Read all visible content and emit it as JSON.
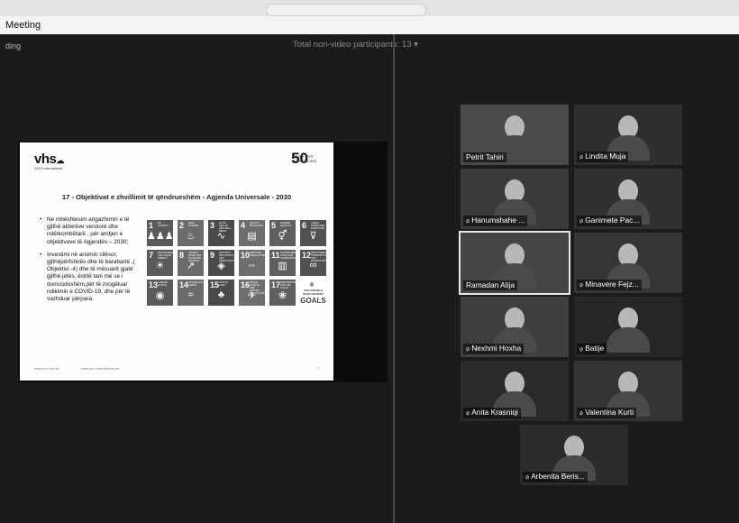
{
  "window": {
    "title": "Meeting"
  },
  "toolbar": {
    "recording_label": "ding",
    "participants_summary": "Total non-video participants: 13"
  },
  "slide": {
    "logo_left": "vhs",
    "logo_left_sub": "DVV International",
    "logo_right_num": "50",
    "logo_right_sub": "Years DVV International",
    "title": "17 - Objektivat e zhvillimit të qëndrueshëm - Agjenda Universale - 2030",
    "bullets": [
      "Ne mbështesim angazhimin e të gjithë akterëve vendorë dhe ndërkombëtarë , për arritjen e objektivave  të Agjendës – 2030;",
      "Investimi në arsimin cilësor, gjithëpërfshirës dhe të barabartë ,( Objektivi -4) dhe të mësuarit gjatë gjithë jetës, është  tani më se i domosdoshëm,për të zvogëluar ndikimin e COVID-19, dhe për të vazhduar përpara."
    ],
    "sdg_tiles": [
      {
        "num": "1",
        "label": "NO POVERTY",
        "icon": "♟♟♟"
      },
      {
        "num": "2",
        "label": "ZERO HUNGER",
        "icon": "♨"
      },
      {
        "num": "3",
        "label": "GOOD HEALTH AND WELL-BEING",
        "icon": "∿"
      },
      {
        "num": "4",
        "label": "QUALITY EDUCATION",
        "icon": "▤"
      },
      {
        "num": "5",
        "label": "GENDER EQUALITY",
        "icon": "⚥"
      },
      {
        "num": "6",
        "label": "CLEAN WATER AND SANITATION",
        "icon": "⊽"
      },
      {
        "num": "7",
        "label": "AFFORDABLE AND CLEAN ENERGY",
        "icon": "☀"
      },
      {
        "num": "8",
        "label": "DECENT WORK AND ECONOMIC GROWTH",
        "icon": "↗"
      },
      {
        "num": "9",
        "label": "INDUSTRY, INNOVATION AND INFRASTRUCTURE",
        "icon": "◈"
      },
      {
        "num": "10",
        "label": "REDUCED INEQUALITIES",
        "icon": "⇔"
      },
      {
        "num": "11",
        "label": "SUSTAINABLE CITIES AND COMMUNITIES",
        "icon": "▥"
      },
      {
        "num": "12",
        "label": "RESPONSIBLE CONSUMPTION AND PRODUCTION",
        "icon": "∞"
      },
      {
        "num": "13",
        "label": "CLIMATE ACTION",
        "icon": "◉"
      },
      {
        "num": "14",
        "label": "LIFE BELOW WATER",
        "icon": "≈"
      },
      {
        "num": "15",
        "label": "LIFE ON LAND",
        "icon": "♣"
      },
      {
        "num": "16",
        "label": "PEACE, JUSTICE AND STRONG INSTITUTIONS",
        "icon": "✈"
      },
      {
        "num": "17",
        "label": "PARTNERSHIPS FOR THE GOALS",
        "icon": "❀"
      }
    ],
    "goals_small": "SUSTAINABLE DEVELOPMENT",
    "goals_big": "GOALS",
    "footer_left": "www.dvv-vhs.de",
    "footer_mid": "www.dvv-international.de",
    "page_num": "7"
  },
  "participants": [
    {
      "name": "Petrit Tahiri",
      "muted": false,
      "video": true,
      "active": false
    },
    {
      "name": "Lindita Muja",
      "muted": true,
      "video": true,
      "active": false
    },
    {
      "name": "Hanumshahe ...",
      "muted": true,
      "video": true,
      "active": false
    },
    {
      "name": "Ganimete Pac...",
      "muted": true,
      "video": true,
      "active": false
    },
    {
      "name": "Ramadan Alija",
      "muted": false,
      "video": true,
      "active": true
    },
    {
      "name": "Minavere Fejz...",
      "muted": true,
      "video": true,
      "active": false
    },
    {
      "name": "Nexhmi Hoxha",
      "muted": true,
      "video": true,
      "active": false
    },
    {
      "name": "Batije",
      "muted": true,
      "video": true,
      "active": false
    },
    {
      "name": "Anita Krasniqi",
      "muted": true,
      "video": true,
      "active": false
    },
    {
      "name": "Valentina Kurti",
      "muted": true,
      "video": true,
      "active": false
    },
    {
      "name": "Arbenita Beris...",
      "muted": true,
      "video": true,
      "active": false
    }
  ]
}
